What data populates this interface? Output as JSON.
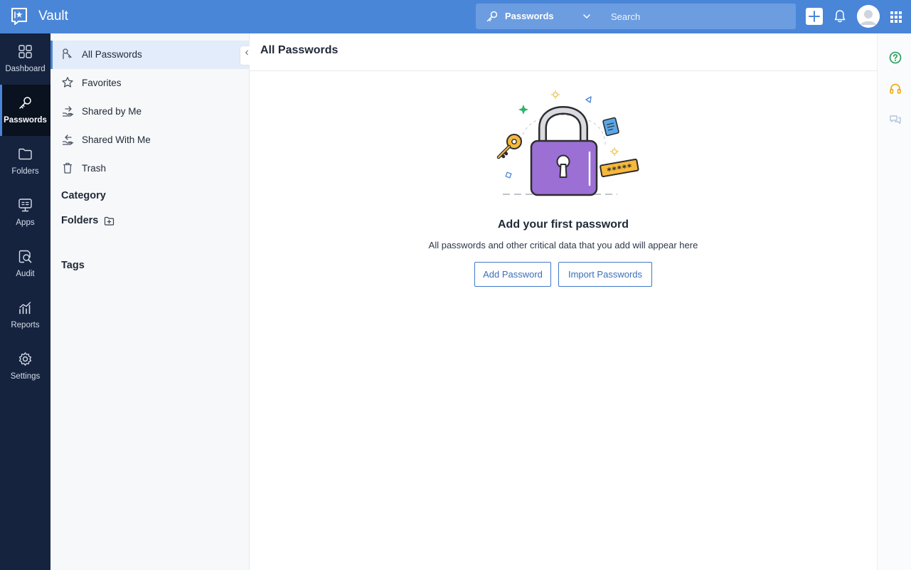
{
  "app": {
    "title": "Vault"
  },
  "header": {
    "module_label": "Passwords",
    "search_placeholder": "Search"
  },
  "nav": {
    "items": [
      {
        "label": "Dashboard",
        "icon": "grid-icon"
      },
      {
        "label": "Passwords",
        "icon": "key-icon",
        "active": true
      },
      {
        "label": "Folders",
        "icon": "folder-icon"
      },
      {
        "label": "Apps",
        "icon": "sso-monitor-icon"
      },
      {
        "label": "Audit",
        "icon": "audit-icon"
      },
      {
        "label": "Reports",
        "icon": "reports-chart-icon"
      },
      {
        "label": "Settings",
        "icon": "gear-icon"
      }
    ]
  },
  "sidebar": {
    "items": [
      {
        "label": "All Passwords",
        "icon": "passwords-icon",
        "active": true
      },
      {
        "label": "Favorites",
        "icon": "star-icon"
      },
      {
        "label": "Shared by Me",
        "icon": "share-out-icon"
      },
      {
        "label": "Shared With Me",
        "icon": "share-in-icon"
      },
      {
        "label": "Trash",
        "icon": "trash-icon"
      }
    ],
    "category_title": "Category",
    "folders_title": "Folders",
    "tags_title": "Tags"
  },
  "main": {
    "title": "All Passwords",
    "empty_state": {
      "title": "Add your first password",
      "description": "All passwords and other critical data that you add will appear here",
      "add_label": "Add Password",
      "import_label": "Import Passwords",
      "illustration_text": "*****"
    }
  },
  "colors": {
    "header": "#4a86d8",
    "nav_bg": "#15233f",
    "accent": "#3f79c9",
    "lock": "#9b6fd4"
  }
}
